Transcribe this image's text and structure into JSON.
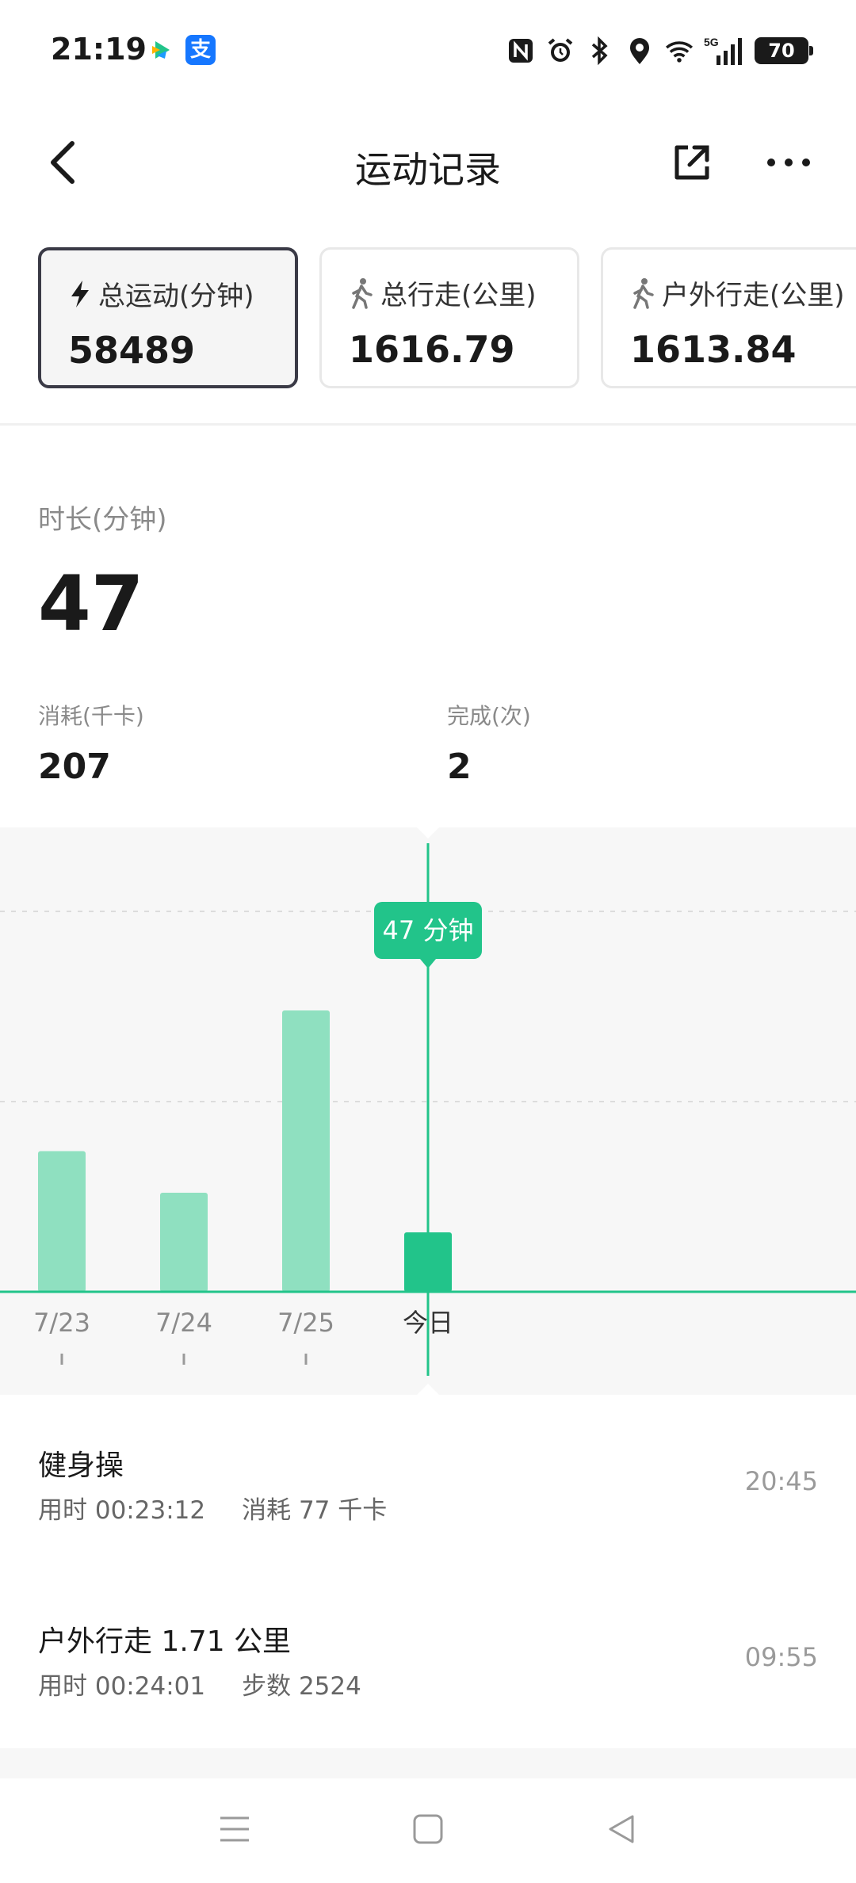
{
  "status_bar": {
    "time": "21:19",
    "alipay_char": "支",
    "battery": "70"
  },
  "header": {
    "title": "运动记录"
  },
  "cards": [
    {
      "label": "总运动(分钟)",
      "value": "58489",
      "icon": "lightning-icon"
    },
    {
      "label": "总行走(公里)",
      "value": "1616.79",
      "icon": "walking-icon"
    },
    {
      "label": "户外行走(公里)",
      "value": "1613.84",
      "icon": "walking-icon"
    }
  ],
  "stats": {
    "duration_label": "时长(分钟)",
    "duration_value": "47",
    "kcal_label": "消耗(千卡)",
    "kcal_value": "207",
    "done_label": "完成(次)",
    "done_value": "2"
  },
  "chart_data": {
    "type": "bar",
    "categories": [
      "7/23",
      "7/24",
      "7/25",
      "今日"
    ],
    "values": [
      71,
      50,
      142,
      30
    ],
    "selected_index": 3,
    "tooltip": "47 分钟",
    "grid": true,
    "colors": {
      "bar": "#8fe0c0",
      "selected": "#22c48a",
      "line": "#22c48a"
    }
  },
  "records": [
    {
      "title": "健身操",
      "duration": "用时 00:23:12",
      "extra": "消耗 77 千卡",
      "time": "20:45"
    },
    {
      "title": "户外行走 1.71 公里",
      "duration": "用时 00:24:01",
      "extra": "步数 2524",
      "time": "09:55"
    }
  ],
  "nav": [
    "menu-icon",
    "home-icon",
    "back-triangle-icon"
  ]
}
